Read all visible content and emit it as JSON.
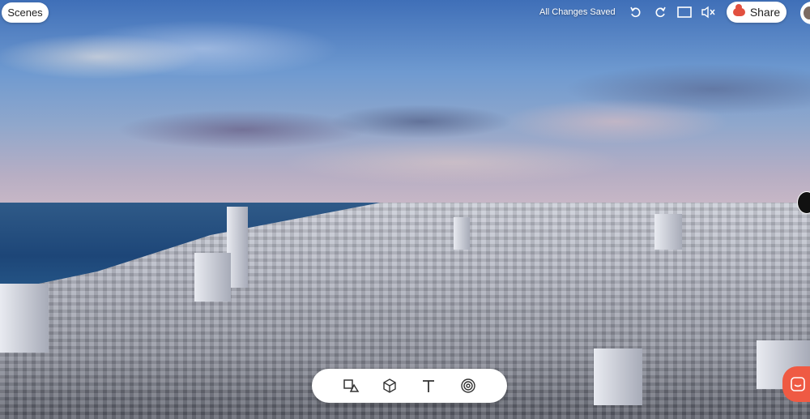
{
  "header": {
    "scenes_label": "Scenes",
    "status_text": "All Changes Saved",
    "share_label": "Share",
    "icons": [
      "undo-icon",
      "redo-icon",
      "fullscreen-icon",
      "mute-icon"
    ]
  },
  "toolbar": {
    "tools": [
      "shapes-icon",
      "cube-icon",
      "text-icon",
      "hotspot-icon"
    ]
  },
  "colors": {
    "accent": "#ef5a43",
    "toolbar_bg": "#ffffff"
  }
}
